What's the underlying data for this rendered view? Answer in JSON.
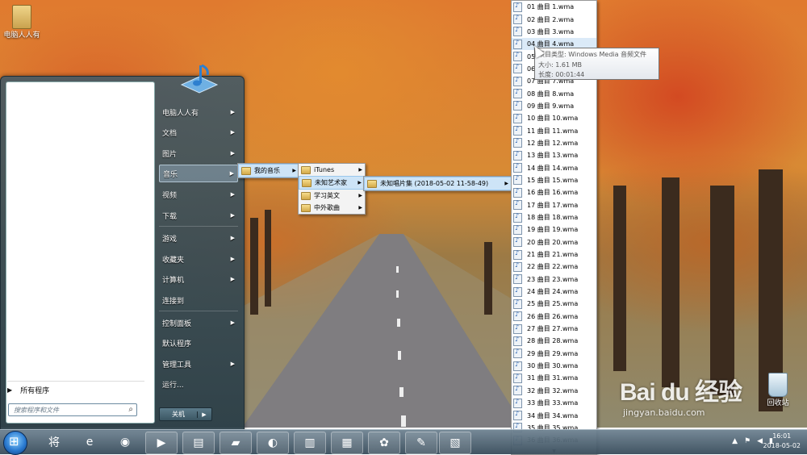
{
  "desktop": {
    "icons": [
      {
        "label": "电脑人人有",
        "icon": "folder-user-icon"
      },
      {
        "label": "回收站",
        "icon": "recycle-bin-icon"
      }
    ]
  },
  "start_menu": {
    "all_programs": "所有程序",
    "search_placeholder": "搜索程序和文件",
    "shutdown_label": "关机",
    "right_items": [
      {
        "label": "电脑人人有",
        "submenu": true
      },
      {
        "label": "文档",
        "submenu": true
      },
      {
        "label": "图片",
        "submenu": true
      },
      {
        "label": "音乐",
        "submenu": true,
        "selected": true
      },
      {
        "label": "视频",
        "submenu": true
      },
      {
        "label": "下载",
        "submenu": true
      },
      {
        "label": "游戏",
        "submenu": true
      },
      {
        "label": "收藏夹",
        "submenu": true
      },
      {
        "label": "计算机",
        "submenu": true
      },
      {
        "label": "连接到",
        "submenu": false
      },
      {
        "label": "控制面板",
        "submenu": true
      },
      {
        "label": "默认程序",
        "submenu": false
      },
      {
        "label": "管理工具",
        "submenu": true
      },
      {
        "label": "运行...",
        "submenu": false
      }
    ]
  },
  "submenus": {
    "music": [
      {
        "label": "我的音乐",
        "selected": true
      }
    ],
    "my_music": [
      {
        "label": "iTunes",
        "selected": false
      },
      {
        "label": "未知艺术家",
        "selected": true
      },
      {
        "label": "学习英文",
        "selected": false
      },
      {
        "label": "中外歌曲",
        "selected": false
      }
    ],
    "unknown_artist": [
      {
        "label": "未知唱片集 (2018-05-02 11-58-49)",
        "selected": true
      }
    ]
  },
  "files": [
    "01 曲目 1.wma",
    "02 曲目 2.wma",
    "03 曲目 3.wma",
    "04 曲目 4.wma",
    "05 曲目 5.wma",
    "06 曲目 6.wma",
    "07 曲目 7.wma",
    "08 曲目 8.wma",
    "09 曲目 9.wma",
    "10 曲目 10.wma",
    "11 曲目 11.wma",
    "12 曲目 12.wma",
    "13 曲目 13.wma",
    "14 曲目 14.wma",
    "15 曲目 15.wma",
    "16 曲目 16.wma",
    "17 曲目 17.wma",
    "18 曲目 18.wma",
    "19 曲目 19.wma",
    "20 曲目 20.wma",
    "21 曲目 21.wma",
    "22 曲目 22.wma",
    "23 曲目 23.wma",
    "24 曲目 24.wma",
    "25 曲目 25.wma",
    "26 曲目 26.wma",
    "27 曲目 27.wma",
    "28 曲目 28.wma",
    "29 曲目 29.wma",
    "30 曲目 30.wma",
    "31 曲目 31.wma",
    "32 曲目 32.wma",
    "33 曲目 33.wma",
    "34 曲目 34.wma",
    "35 曲目 35.wma",
    "36 曲目 36.wma"
  ],
  "selected_file_index": 3,
  "tooltip": {
    "type": "项目类型: Windows Media 音频文件",
    "size": "大小: 1.61 MB",
    "length": "长度: 00:01:44"
  },
  "taskbar": {
    "buttons": [
      {
        "name": "start-orb",
        "icon": "windows-logo-icon"
      },
      {
        "name": "jiang-app",
        "icon": "jiang-icon",
        "glyph": "将"
      },
      {
        "name": "ie-browser",
        "icon": "internet-explorer-icon",
        "glyph": "e"
      },
      {
        "name": "chrome",
        "icon": "chrome-icon",
        "glyph": "◉"
      },
      {
        "name": "media-player",
        "icon": "media-player-icon",
        "glyph": "▶"
      },
      {
        "name": "file-explorer",
        "icon": "file-explorer-icon",
        "glyph": "▤"
      },
      {
        "name": "folder",
        "icon": "folder-icon",
        "glyph": "▰"
      },
      {
        "name": "browser-alt",
        "icon": "browser-icon",
        "glyph": "◐"
      },
      {
        "name": "document",
        "icon": "document-icon",
        "glyph": "▥"
      },
      {
        "name": "control-panel",
        "icon": "control-panel-icon",
        "glyph": "▦"
      },
      {
        "name": "paint-app",
        "icon": "paint-flower-icon",
        "glyph": "✿"
      },
      {
        "name": "paint",
        "icon": "paint-brush-icon",
        "glyph": "✎"
      },
      {
        "name": "notebook",
        "icon": "notebook-icon",
        "glyph": "▧"
      }
    ],
    "tray_icons": [
      "chevron-up-icon",
      "flag-icon",
      "volume-icon",
      "network-icon"
    ],
    "time": "16:01",
    "date": "2018-05-02"
  },
  "watermark": {
    "brand": "Bai du 经验",
    "url": "jingyan.baidu.com"
  }
}
